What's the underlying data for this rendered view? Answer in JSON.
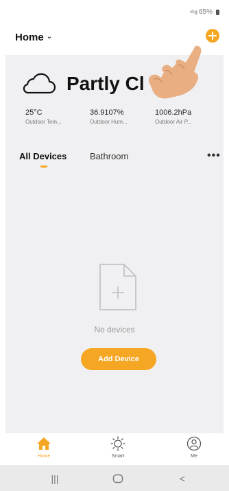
{
  "status_bar": {
    "signal": "⁵ᴳ.ıl",
    "battery": "65%"
  },
  "header": {
    "title": "Home"
  },
  "weather": {
    "condition": "Partly Cl",
    "stats": [
      {
        "value": "25°C",
        "label": "Outdoor Tem..."
      },
      {
        "value": "36.9107%",
        "label": "Outdoor Hum..."
      },
      {
        "value": "1006.2hPa",
        "label": "Outdoor Air P..."
      }
    ]
  },
  "tabs": [
    {
      "label": "All Devices",
      "active": true
    },
    {
      "label": "Bathroom",
      "active": false
    }
  ],
  "more": "•••",
  "empty_state": {
    "text": "No devices",
    "button": "Add Device"
  },
  "bottom_nav": [
    {
      "label": "Home",
      "icon": "home-icon",
      "active": true
    },
    {
      "label": "Smart",
      "icon": "sun-icon",
      "active": false
    },
    {
      "label": "Me",
      "icon": "profile-icon",
      "active": false
    }
  ],
  "system_nav": {
    "recent": "|||",
    "home": "○",
    "back": "<"
  },
  "colors": {
    "accent": "#f5a623",
    "background": "#f0f0f2"
  }
}
